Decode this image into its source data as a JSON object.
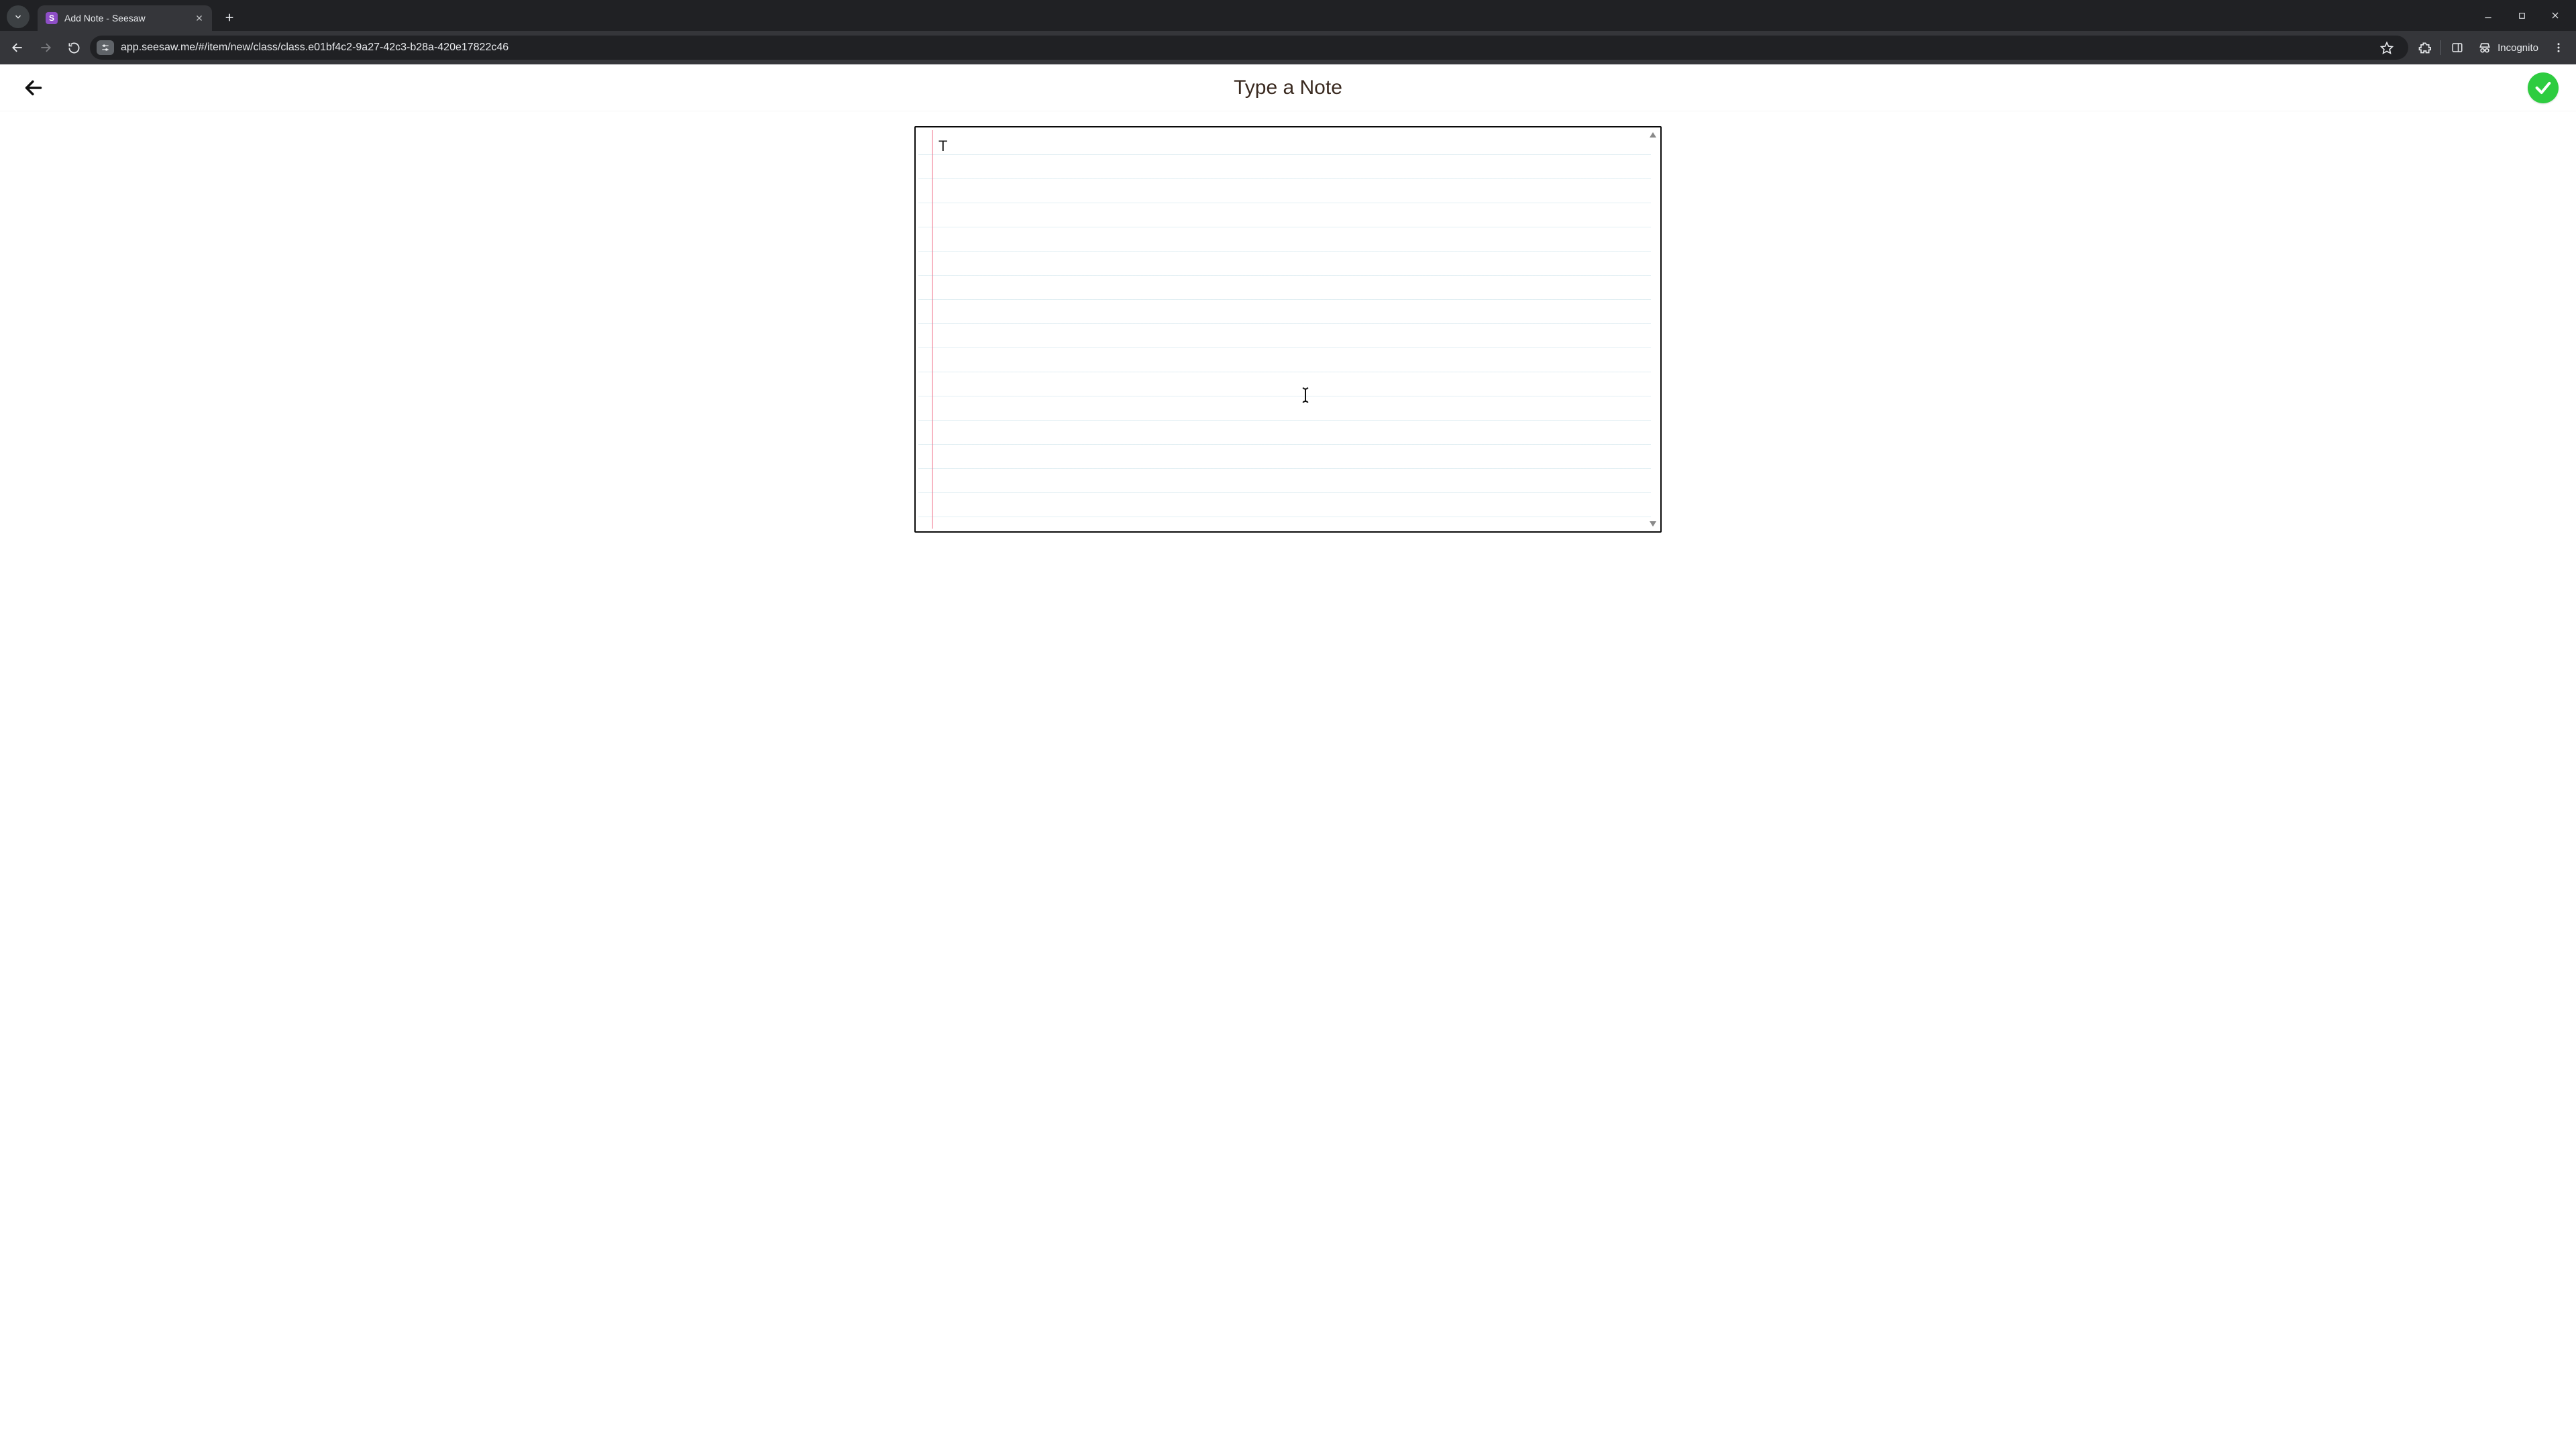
{
  "browser": {
    "tab": {
      "title": "Add Note - Seesaw",
      "favicon_letter": "S"
    },
    "url": "app.seesaw.me/#/item/new/class/class.e01bf4c2-9a27-42c3-b28a-420e17822c46",
    "incognito_label": "Incognito"
  },
  "app": {
    "header_title": "Type a Note",
    "note_text": "T"
  },
  "colors": {
    "accent_green": "#2ecc40",
    "favicon_purple": "#8e4ec6",
    "margin_pink": "#f7b5c2"
  }
}
